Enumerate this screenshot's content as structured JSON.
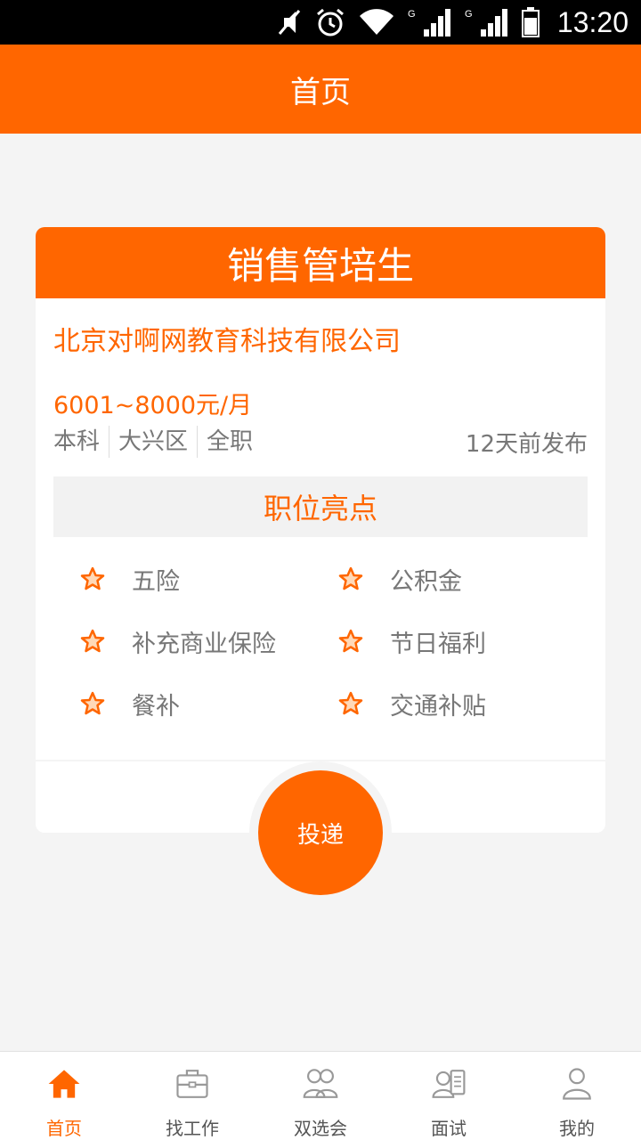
{
  "status_bar": {
    "time": "13:20"
  },
  "header": {
    "title": "首页"
  },
  "job": {
    "title": "销售管培生",
    "company": "北京对啊网教育科技有限公司",
    "salary": "6001~8000元/月",
    "tags": [
      "本科",
      "大兴区",
      "全职"
    ],
    "posted": "12天前发布",
    "highlights_title": "职位亮点",
    "benefits": [
      "五险",
      "公积金",
      "补充商业保险",
      "节日福利",
      "餐补",
      "交通补贴"
    ]
  },
  "apply_label": "投递",
  "nav": {
    "items": [
      {
        "label": "首页",
        "icon": "home-icon",
        "active": true
      },
      {
        "label": "找工作",
        "icon": "briefcase-icon",
        "active": false
      },
      {
        "label": "双选会",
        "icon": "people-icon",
        "active": false
      },
      {
        "label": "面试",
        "icon": "interview-icon",
        "active": false
      },
      {
        "label": "我的",
        "icon": "person-icon",
        "active": false
      }
    ]
  },
  "colors": {
    "accent": "#ff6600",
    "background": "#f4f4f4"
  }
}
